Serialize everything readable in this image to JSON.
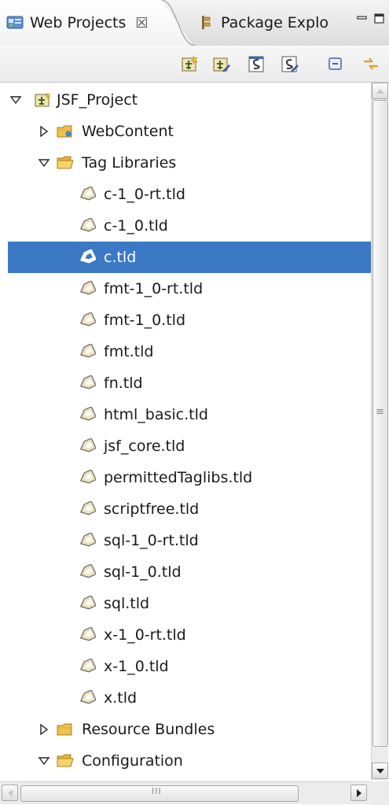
{
  "tabs": [
    {
      "label": "Web Projects",
      "close": "☒",
      "active": true,
      "icon": "web-projects-icon"
    },
    {
      "label": "Package Explo",
      "active": false,
      "icon": "package-explorer-icon"
    }
  ],
  "window_buttons": [
    "minimize",
    "maximize"
  ],
  "toolbar": {
    "buttons": [
      "new-project-icon",
      "new-project-wizard-icon",
      "new-file-icon",
      "new-file-wizard-icon",
      "collapse-all-icon",
      "link-with-editor-icon"
    ]
  },
  "tree": {
    "root": {
      "label": "JSF_Project",
      "expanded": true,
      "icon": "project-icon"
    },
    "web_content": {
      "label": "WebContent",
      "expanded": false,
      "icon": "folder-icon"
    },
    "tag_libraries": {
      "label": "Tag Libraries",
      "expanded": true,
      "icon": "folder-open-icon"
    },
    "tld_files": [
      "c-1_0-rt.tld",
      "c-1_0.tld",
      "c.tld",
      "fmt-1_0-rt.tld",
      "fmt-1_0.tld",
      "fmt.tld",
      "fn.tld",
      "html_basic.tld",
      "jsf_core.tld",
      "permittedTaglibs.tld",
      "scriptfree.tld",
      "sql-1_0-rt.tld",
      "sql-1_0.tld",
      "sql.tld",
      "x-1_0-rt.tld",
      "x-1_0.tld",
      "x.tld"
    ],
    "selected": "c.tld",
    "resource_bundles": {
      "label": "Resource Bundles",
      "expanded": false,
      "icon": "folder-icon"
    },
    "configuration": {
      "label": "Configuration",
      "expanded": true,
      "icon": "folder-open-icon"
    }
  },
  "scrollbars": {
    "vertical_position": 0.0,
    "horizontal_position": 0.0,
    "grip": "≡",
    "hgrip": "III"
  },
  "colors": {
    "selection": "#3b79c4",
    "folder": "#f2c14e",
    "tld_icon": "#e8d9a8"
  }
}
